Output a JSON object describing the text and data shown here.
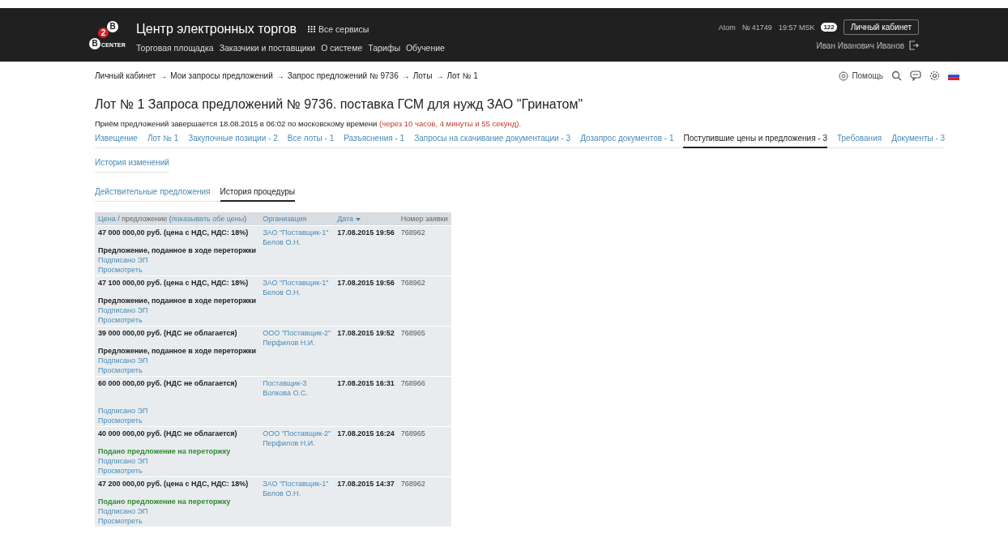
{
  "header": {
    "logo": {
      "top": "B",
      "badge": "2",
      "main": "B",
      "caption": "CENTER"
    },
    "title": "Центр электронных торгов",
    "services": "Все сервисы",
    "nav": [
      "Торговая площадка",
      "Заказчики и поставщики",
      "О системе",
      "Тарифы",
      "Обучение"
    ],
    "site": "Atom",
    "number": "№ 41749",
    "time": "19:57 MSK",
    "messages": "122",
    "cabinet": "Личный кабинет",
    "user": "Иван Иванович Иванов"
  },
  "breadcrumbs": {
    "separator": "→",
    "items": [
      "Личный кабинет",
      "Мои запросы предложений",
      "Запрос предложений № 9736",
      "Лоты",
      "Лот № 1"
    ]
  },
  "toolbar": {
    "help": "Помощь"
  },
  "title": "Лот № 1 Запроса предложений № 9736. поставка ГСМ для нужд ЗАО \"Гринатом\"",
  "deadline": {
    "text": "Приём предложений завершается 18.08.2015 в 06:02 по московскому времени",
    "remaining": "(через 10 часов, 4 минуты и 55 секунд)."
  },
  "tab_rows": [
    [
      {
        "label": "Извещение",
        "selected": false
      },
      {
        "label": "Лот № 1",
        "selected": false
      },
      {
        "label": "Закупочные позиции - 2",
        "selected": false
      },
      {
        "label": "Все лоты - 1",
        "selected": false
      },
      {
        "label": "Разъяснения - 1",
        "selected": false
      },
      {
        "label": "Запросы на скачивание документации - 3",
        "selected": false
      },
      {
        "label": "Дозапрос документов - 1",
        "selected": false
      },
      {
        "label": "Поступившие цены и предложения - 3",
        "selected": true
      },
      {
        "label": "Требования",
        "selected": false
      },
      {
        "label": "Документы - 3",
        "selected": false
      }
    ],
    [
      {
        "label": "История изменений",
        "selected": false
      }
    ]
  ],
  "subtabs": [
    {
      "label": "Действительные предложения",
      "selected": false
    },
    {
      "label": "История процедуры",
      "selected": true
    }
  ],
  "table": {
    "columns": [
      {
        "kind": "compound",
        "label": "Цена",
        "rest": "/ предложение (",
        "link": "показывать обе цены",
        "end": ")",
        "sorted": false
      },
      {
        "kind": "link",
        "label": "Организация",
        "sorted": false
      },
      {
        "kind": "link",
        "label": "Дата",
        "sorted": true
      },
      {
        "kind": "text",
        "label": "Номер заявки",
        "sorted": false
      }
    ],
    "rows": [
      {
        "price": "47 000 000,00 руб. (цена с НДС, НДС: 18%)",
        "note": "Предложение, поданное в ходе переторжки",
        "kind": "rebid",
        "signed": "Подписано ЭП",
        "view": "Просмотреть",
        "org": "ЗАО \"Поставщик-1\"",
        "person": "Белов О.Н.",
        "date": "17.08.2015 19:56",
        "number": "768962"
      },
      {
        "price": "47 100 000,00 руб. (цена с НДС, НДС: 18%)",
        "note": "Предложение, поданное в ходе переторжки",
        "kind": "rebid",
        "signed": "Подписано ЭП",
        "view": "Просмотреть",
        "org": "ЗАО \"Поставщик-1\"",
        "person": "Белов О.Н.",
        "date": "17.08.2015 19:56",
        "number": "768962"
      },
      {
        "price": "39 000 000,00 руб. (НДС не облагается)",
        "note": "Предложение, поданное в ходе переторжки",
        "kind": "rebid",
        "signed": "Подписано ЭП",
        "view": "Просмотреть",
        "org": "ООО \"Поставщик-2\"",
        "person": "Перфилов Н.И.",
        "date": "17.08.2015 19:52",
        "number": "768965"
      },
      {
        "price": "60 000 000,00 руб. (НДС не облагается)",
        "signed": "Подписано ЭП",
        "view": "Просмотреть",
        "org": "Поставщик-3",
        "person": "Волкова О.С.",
        "date": "17.08.2015 16:31",
        "number": "768966"
      },
      {
        "price": "40 000 000,00 руб. (НДС не облагается)",
        "note": "Подано предложение на переторжку",
        "kind": "submitted",
        "signed": "Подписано ЭП",
        "view": "Просмотреть",
        "org": "ООО \"Поставщик-2\"",
        "person": "Перфилов Н.И.",
        "date": "17.08.2015 16:24",
        "number": "768965"
      },
      {
        "price": "47 200 000,00 руб. (цена с НДС, НДС: 18%)",
        "note": "Подано предложение на переторжку",
        "kind": "submitted",
        "signed": "Подписано ЭП",
        "view": "Просмотреть",
        "org": "ЗАО \"Поставщик-1\"",
        "person": "Белов О.Н.",
        "date": "17.08.2015 14:37",
        "number": "768962"
      }
    ]
  }
}
